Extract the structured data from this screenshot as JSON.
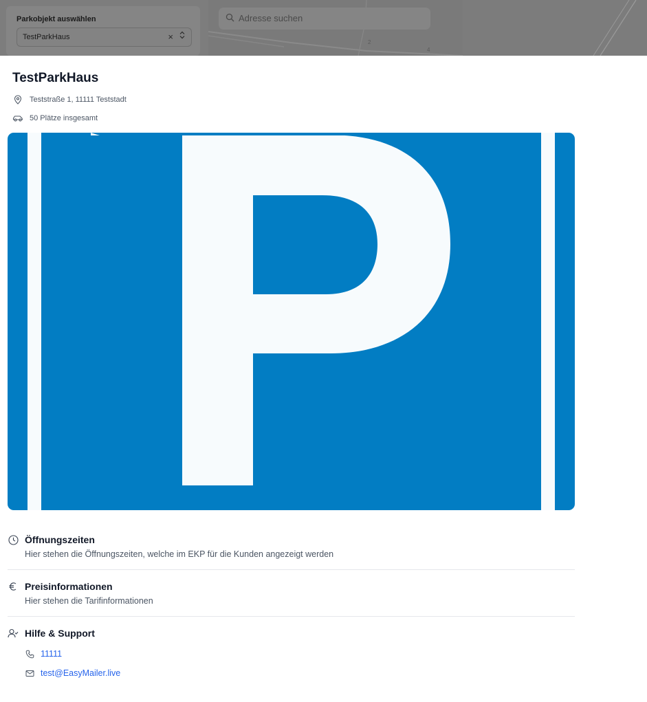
{
  "background": {
    "selector_label": "Parkobjekt auswählen",
    "selector_value": "TestParkHaus",
    "clear_glyph": "×",
    "search_placeholder": "Adresse suchen"
  },
  "sheet": {
    "title": "TestParkHaus",
    "address": "Teststraße 1, 11111 Teststadt",
    "spaces": "50 Plätze insgesamt",
    "image_icon": "parking-sign-image",
    "sections": {
      "hours": {
        "title": "Öffnungszeiten",
        "description": "Hier stehen die Öffnungszeiten, welche im EKP für die Kunden angezeigt werden",
        "icon": "clock-icon"
      },
      "prices": {
        "title": "Preisinformationen",
        "description": "Hier stehen die Tarifinformationen",
        "icon": "euro-icon"
      },
      "support": {
        "title": "Hilfe & Support",
        "icon": "user-check-icon"
      }
    },
    "contact": {
      "phone": "11111",
      "email": "test@EasyMailer.live"
    }
  },
  "colors": {
    "parking_blue": "#027dc3",
    "parking_white": "#f7fbfd",
    "link": "#2563eb",
    "text_primary": "#111827",
    "text_secondary": "#4b5563"
  }
}
